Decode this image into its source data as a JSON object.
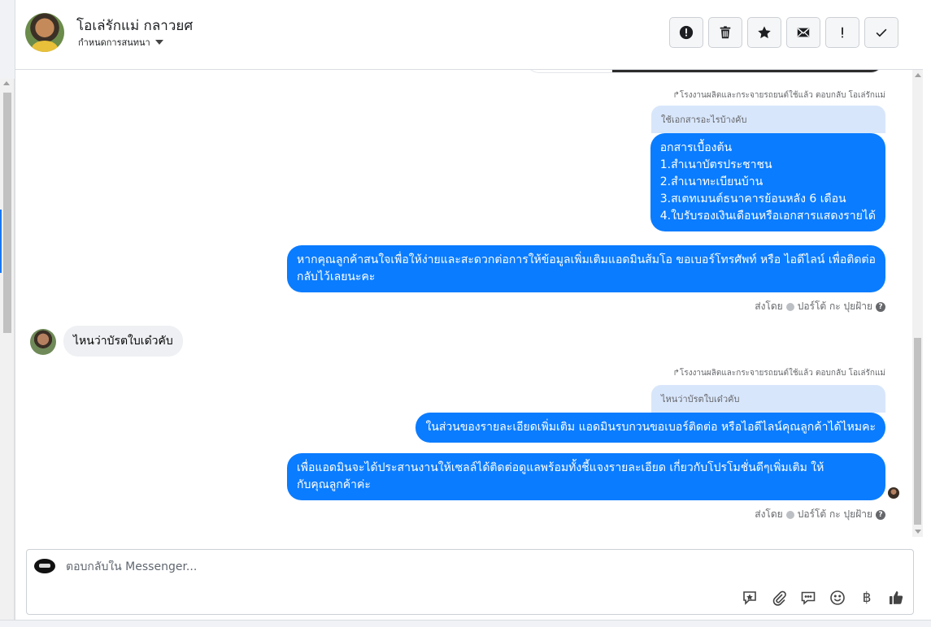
{
  "header": {
    "contact_name": "โอเล่รักแม่ กลาวยศ",
    "assign_label": "กำหนดการสนทนา",
    "actions": [
      {
        "name": "spam-button",
        "icon": "alert-circle-icon"
      },
      {
        "name": "delete-button",
        "icon": "trash-icon"
      },
      {
        "name": "star-button",
        "icon": "star-icon"
      },
      {
        "name": "mark-unread-button",
        "icon": "envelope-icon"
      },
      {
        "name": "follow-up-button",
        "icon": "exclamation-icon"
      },
      {
        "name": "done-button",
        "icon": "check-icon"
      }
    ]
  },
  "thread": {
    "reply_note_1": "โรงงานผลิตและกระจายรถยนต์ใช้แล้ว ตอบกลับ โอเล่รักแม่",
    "quoted_1": "ใช้เอกสารอะไรบ้างคับ",
    "msg_docs_lines": [
      "อกสารเบื้องต้น",
      "1.สำเนาบัตรประชาชน",
      "2.สำเนาทะเบียนบ้าน",
      "3.สเตทเมนต์ธนาคารย้อนหลัง 6 เดือน",
      "4.ใบรับรองเงินเดือนหรือเอกสารแสดงรายได้"
    ],
    "msg_contact_info": "หากคุณลูกค้าสนใจเพื่อให้ง่ายและสะดวกต่อการให้ข้อมูลเพิ่มเติมแอดมินส้มโอ ขอเบอร์โทรศัพท์ หรือ ไอดีไลน์ เพื่อติดต่อกลับไว้เลยนะคะ",
    "sent_by_1": "ส่งโดย",
    "agent_name_1": "ปอร์โต้ กะ ปุยฝ้าย",
    "incoming_1": "ไหนว่าบัรตใบเด๋วคับ",
    "reply_note_2": "โรงงานผลิตและกระจายรถยนต์ใช้แล้ว ตอบกลับ โอเล่รักแม่",
    "quoted_2": "ไหนว่าบัรตใบเด๋วคับ",
    "msg_ask_phone": "ในส่วนของรายละเอียดเพิ่มเติม แอดมินรบกวนขอเบอร์ติดต่อ หรือไอดีไลน์คุณลูกค้าได้ไหมคะ",
    "msg_sales_line1": "เพื่อแอดมินจะได้ประสานงานให้เซลล์ได้ติดต่อดูแลพร้อมทั้งชี้แจงรายละเอียด เกี่ยวกับโปรโมชั่นดีๆเพิ่มเติม ให้",
    "msg_sales_line2": "กับคุณลูกค้าค่ะ",
    "sent_by_2": "ส่งโดย",
    "agent_name_2": "ปอร์โต้ กะ ปุยฝ้าย"
  },
  "composer": {
    "placeholder": "ตอบกลับใน Messenger...",
    "tools": [
      "saved-reply-icon",
      "attachment-icon",
      "chat-bubble-icon",
      "emoji-icon",
      "baht-icon",
      "like-icon"
    ]
  }
}
